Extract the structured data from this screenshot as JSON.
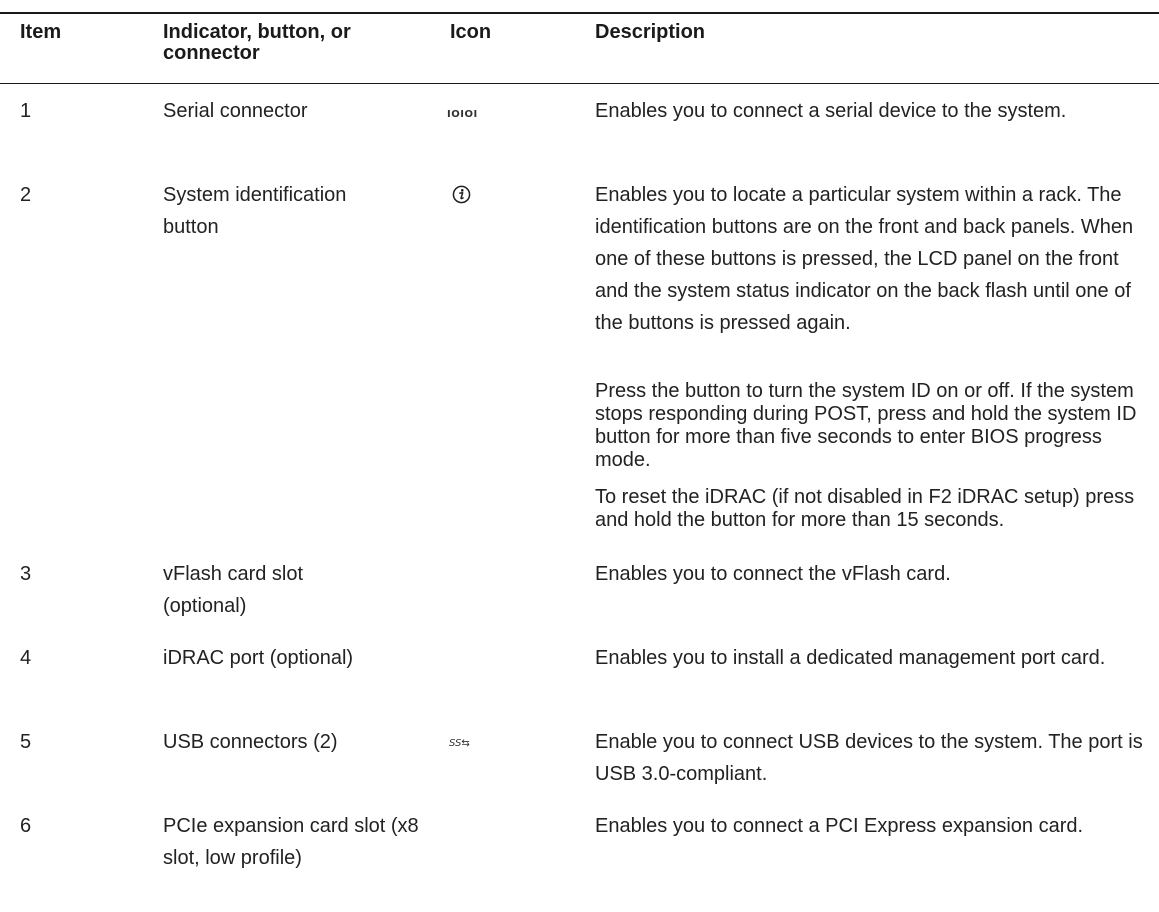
{
  "header": {
    "item": "Item",
    "indicator": "Indicator, button, or connector",
    "icon": "Icon",
    "description": "Description"
  },
  "rows": [
    {
      "item": "1",
      "indicator": "Serial connector",
      "icon": "serial-connector-icon",
      "icon_text": "IOIOI",
      "description": [
        "Enables you to connect a serial device to the system."
      ]
    },
    {
      "item": "2",
      "indicator": "System identification button",
      "icon": "info-icon",
      "description": [
        "Enables you to locate a particular system within a rack. The identification buttons are on the front and back panels. When one of these buttons is pressed, the LCD panel on the front and the system status indicator on the back flash until one of the buttons is pressed again.",
        "Press the button to turn the system ID on or off. If the system stops responding during POST, press and hold the system ID button for more than five seconds to enter BIOS progress mode.",
        "To reset the iDRAC (if not disabled in F2 iDRAC setup) press and hold the button for more than 15 seconds."
      ]
    },
    {
      "item": "3",
      "indicator": "vFlash card slot (optional)",
      "description": [
        "Enables you to connect the vFlash card."
      ]
    },
    {
      "item": "4",
      "indicator": "iDRAC port (optional)",
      "description": [
        "Enables you to install a dedicated management port card."
      ]
    },
    {
      "item": "5",
      "indicator": "USB connectors (2)",
      "icon": "usb-ss-icon",
      "icon_text": "SS⇆",
      "description": [
        "Enable you to connect USB devices to the system. The port is USB 3.0-compliant."
      ]
    },
    {
      "item": "6",
      "indicator": "PCIe expansion card slot (x8 slot, low profile)",
      "description": [
        "Enables you to connect a PCI Express expansion card."
      ]
    }
  ]
}
